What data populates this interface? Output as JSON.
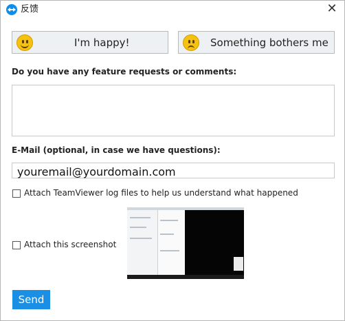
{
  "window": {
    "title": "反馈",
    "close_glyph": "✕"
  },
  "mood": {
    "happy_label": "I'm happy!",
    "bothers_label": "Something bothers me"
  },
  "feature": {
    "heading": "Do you have any feature requests or comments:",
    "value": ""
  },
  "email": {
    "heading": "E-Mail (optional, in case we have questions):",
    "value": "youremail@yourdomain.com"
  },
  "attach_logs": {
    "label": "Attach TeamViewer log files to help us understand what happened",
    "checked": false
  },
  "attach_screenshot": {
    "label": "Attach this screenshot",
    "checked": false
  },
  "send_label": "Send",
  "colors": {
    "accent": "#1a8fe3",
    "button_bg": "#eef1f3",
    "smiley": "#f4c20f"
  },
  "icons": [
    "teamviewer-icon",
    "close-icon",
    "happy-smiley-icon",
    "sad-smiley-icon",
    "scroll-up-icon",
    "scroll-down-icon"
  ]
}
